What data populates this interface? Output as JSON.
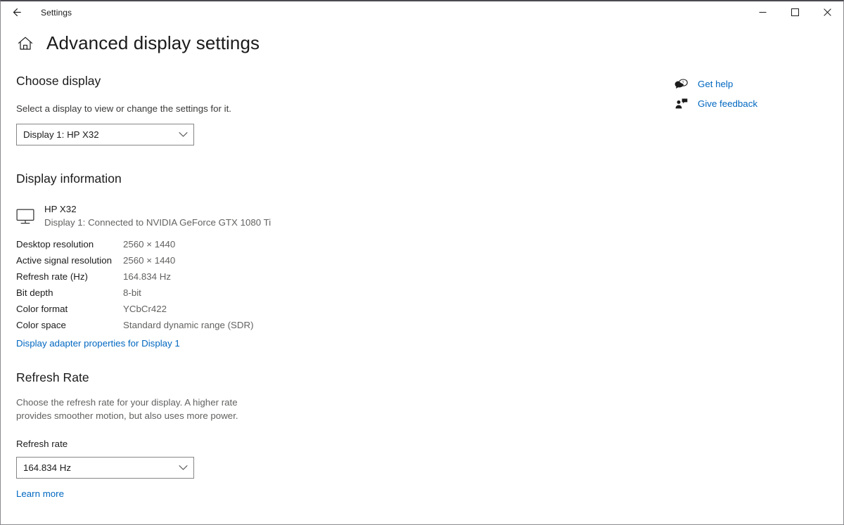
{
  "window": {
    "titlebar_title": "Settings",
    "back_icon": "arrow-left-icon",
    "minimize_label": "—",
    "maximize_label": "☐",
    "close_label": "✕"
  },
  "page": {
    "home_icon": "home-icon",
    "title": "Advanced display settings"
  },
  "right_rail": {
    "links": [
      {
        "label": "Get help",
        "icon": "help-chat-icon"
      },
      {
        "label": "Give feedback",
        "icon": "feedback-person-icon"
      }
    ]
  },
  "colors": {
    "link": "#0067c0",
    "text": "#1b1b1b",
    "muted": "#636261",
    "border": "#868686"
  },
  "choose_display": {
    "heading": "Choose display",
    "description": "Select a display to view or change the settings for it.",
    "selected": "Display 1: HP X32",
    "chevron_icon": "chevron-down-icon"
  },
  "display_information": {
    "heading": "Display information",
    "monitor_icon": "monitor-icon",
    "monitor_name": "HP X32",
    "monitor_connection": "Display 1: Connected to NVIDIA GeForce GTX 1080 Ti",
    "rows": [
      {
        "key": "Desktop resolution",
        "value": "2560 × 1440"
      },
      {
        "key": "Active signal resolution",
        "value": "2560 × 1440"
      },
      {
        "key": "Refresh rate (Hz)",
        "value": "164.834 Hz"
      },
      {
        "key": "Bit depth",
        "value": "8-bit"
      },
      {
        "key": "Color format",
        "value": "YCbCr422"
      },
      {
        "key": "Color space",
        "value": "Standard dynamic range (SDR)"
      }
    ],
    "adapter_link": "Display adapter properties for Display 1"
  },
  "refresh_rate": {
    "heading": "Refresh Rate",
    "description": "Choose the refresh rate for your display. A higher rate provides smoother motion, but also uses more power.",
    "field_label": "Refresh rate",
    "selected": "164.834 Hz",
    "chevron_icon": "chevron-down-icon",
    "learn_more": "Learn more"
  }
}
